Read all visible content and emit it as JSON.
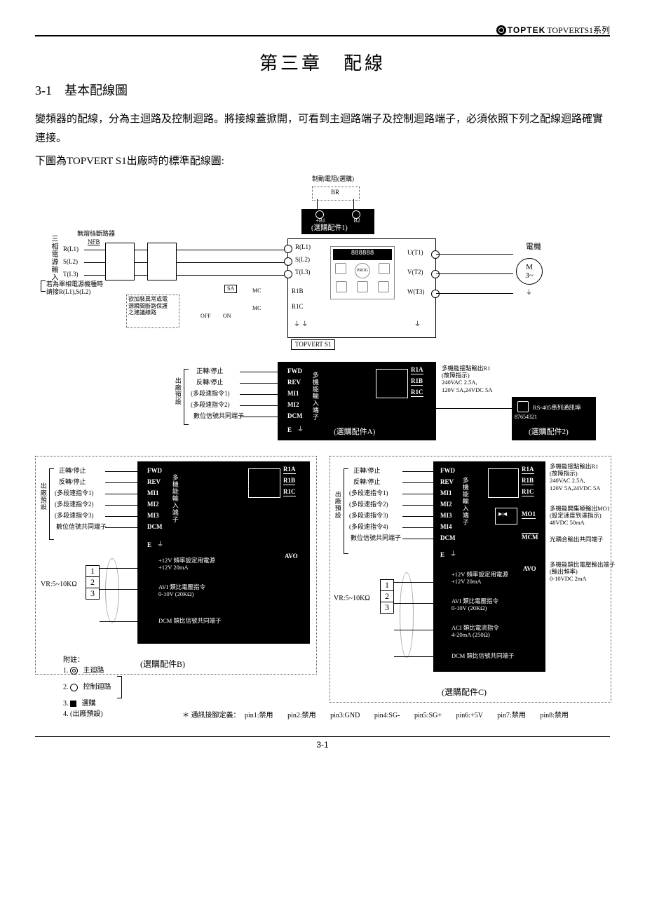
{
  "header": {
    "brand": "TOPTEK",
    "series": "TOPVERTS1系列"
  },
  "chapter": {
    "title": "第三章　配線"
  },
  "section": {
    "heading": "3-1　基本配線圖"
  },
  "paragraphs": {
    "p1": "變頻器的配線，分為主迴路及控制迴路。將接線蓋掀開，可看到主迴路端子及控制迴路端子，必須依照下列之配線迴路確實連接。",
    "p2": "下圖為TOPVERT S1出廠時的標準配線圖:"
  },
  "diagram": {
    "brake_resistor": "制動電阻(選購)",
    "br_label": "BR",
    "b1": "+B1",
    "b2": "B2",
    "option1": "(選購配件1)",
    "power_in_title": "三相電源輸入",
    "nfb_title": "無熔絲斷路器",
    "nfb": "NFB",
    "rl1": "R(L1)",
    "sl2": "S(L2)",
    "tl3": "T(L3)",
    "single_phase_note": "若為單相電源機種時\n請接R(L1),S(L2)",
    "surge_note": "欲加裝異常或電\n源瞬間斷路保護\n之建議線路",
    "sa": "SA",
    "mc": "MC",
    "off": "OFF",
    "on": "ON",
    "r1b": "R1B",
    "r1c": "R1C",
    "main_r": "R(L1)",
    "main_s": "S(L2)",
    "main_t": "T(L3)",
    "ut1": "U(T1)",
    "vt2": "V(T2)",
    "wt3": "W(T3)",
    "topvert": "TOPVERT S1",
    "motor_label": "電機",
    "motor_m": "M",
    "motor_3": "3~",
    "factory_set": "出廠預設",
    "fwd_stop": "正轉/停止",
    "rev_stop": "反轉/停止",
    "ms1": "(多段速指令1)",
    "ms2": "(多段速指令2)",
    "ms3": "(多段速指令3)",
    "ms4": "(多段速指令4)",
    "dcm_note": "數位信號共同端子",
    "FWD": "FWD",
    "REV": "REV",
    "MI1": "MI1",
    "MI2": "MI2",
    "MI3": "MI3",
    "MI4": "MI4",
    "DCM": "DCM",
    "E": "E",
    "mi_title": "多機能輸入端子",
    "R1A": "R1A",
    "R1B": "R1B",
    "R1C": "R1C",
    "MO1": "MO1",
    "MCM": "MCM",
    "r1_note": "多機能接點輸出R1\n(故障指示)\n240VAC 2.5A,\n120V 5A,24VDC 5A",
    "mo1_note": "多機能開集極輸出MO1\n(設定速度到達指示)\n48VDC 50mA",
    "mcm_note": "光耦合輸出共同端子",
    "avo": "AVO",
    "avo_note": "多機能類比電壓輸出端子\n(輸出頻率)\n0-10VDC 2mA",
    "p12": "+12V 頻率設定用電源\n+12V 20mA",
    "avi": "AVI 類比電壓指令\n0-10V (20KΩ)",
    "aci": "ACI 類比電流指令\n4-20mA (250Ω)",
    "dcm2": "DCM 類比信號共同端子",
    "vr": "VR:5~10KΩ",
    "vr1": "1",
    "vr2": "2",
    "vr3": "3",
    "optA": "(選購配件A)",
    "optB": "(選購配件B)",
    "optC": "(選購配件C)",
    "opt2": "(選購配件2)",
    "rs485": "RS-485串列通訊埠",
    "rs485pin": "87654321",
    "legend_title": "附註：",
    "legend1": "1.",
    "legend1t": "主迴路",
    "legend2": "2.",
    "legend2t": "控制迴路",
    "legend3": "3.",
    "legend3t": "選購",
    "legend4": "4. (出廠預設)",
    "pin_intro": "＊ 通訊接腳定義：",
    "pin1": "pin1:禁用",
    "pin2": "pin2:禁用",
    "pin3": "pin3:GND",
    "pin4": "pin4:SG-",
    "pin5": "pin5:SG+",
    "pin6": "pin6:+5V",
    "pin7": "pin7:禁用",
    "pin8": "pin8:禁用"
  },
  "footer": {
    "page": "3-1"
  }
}
